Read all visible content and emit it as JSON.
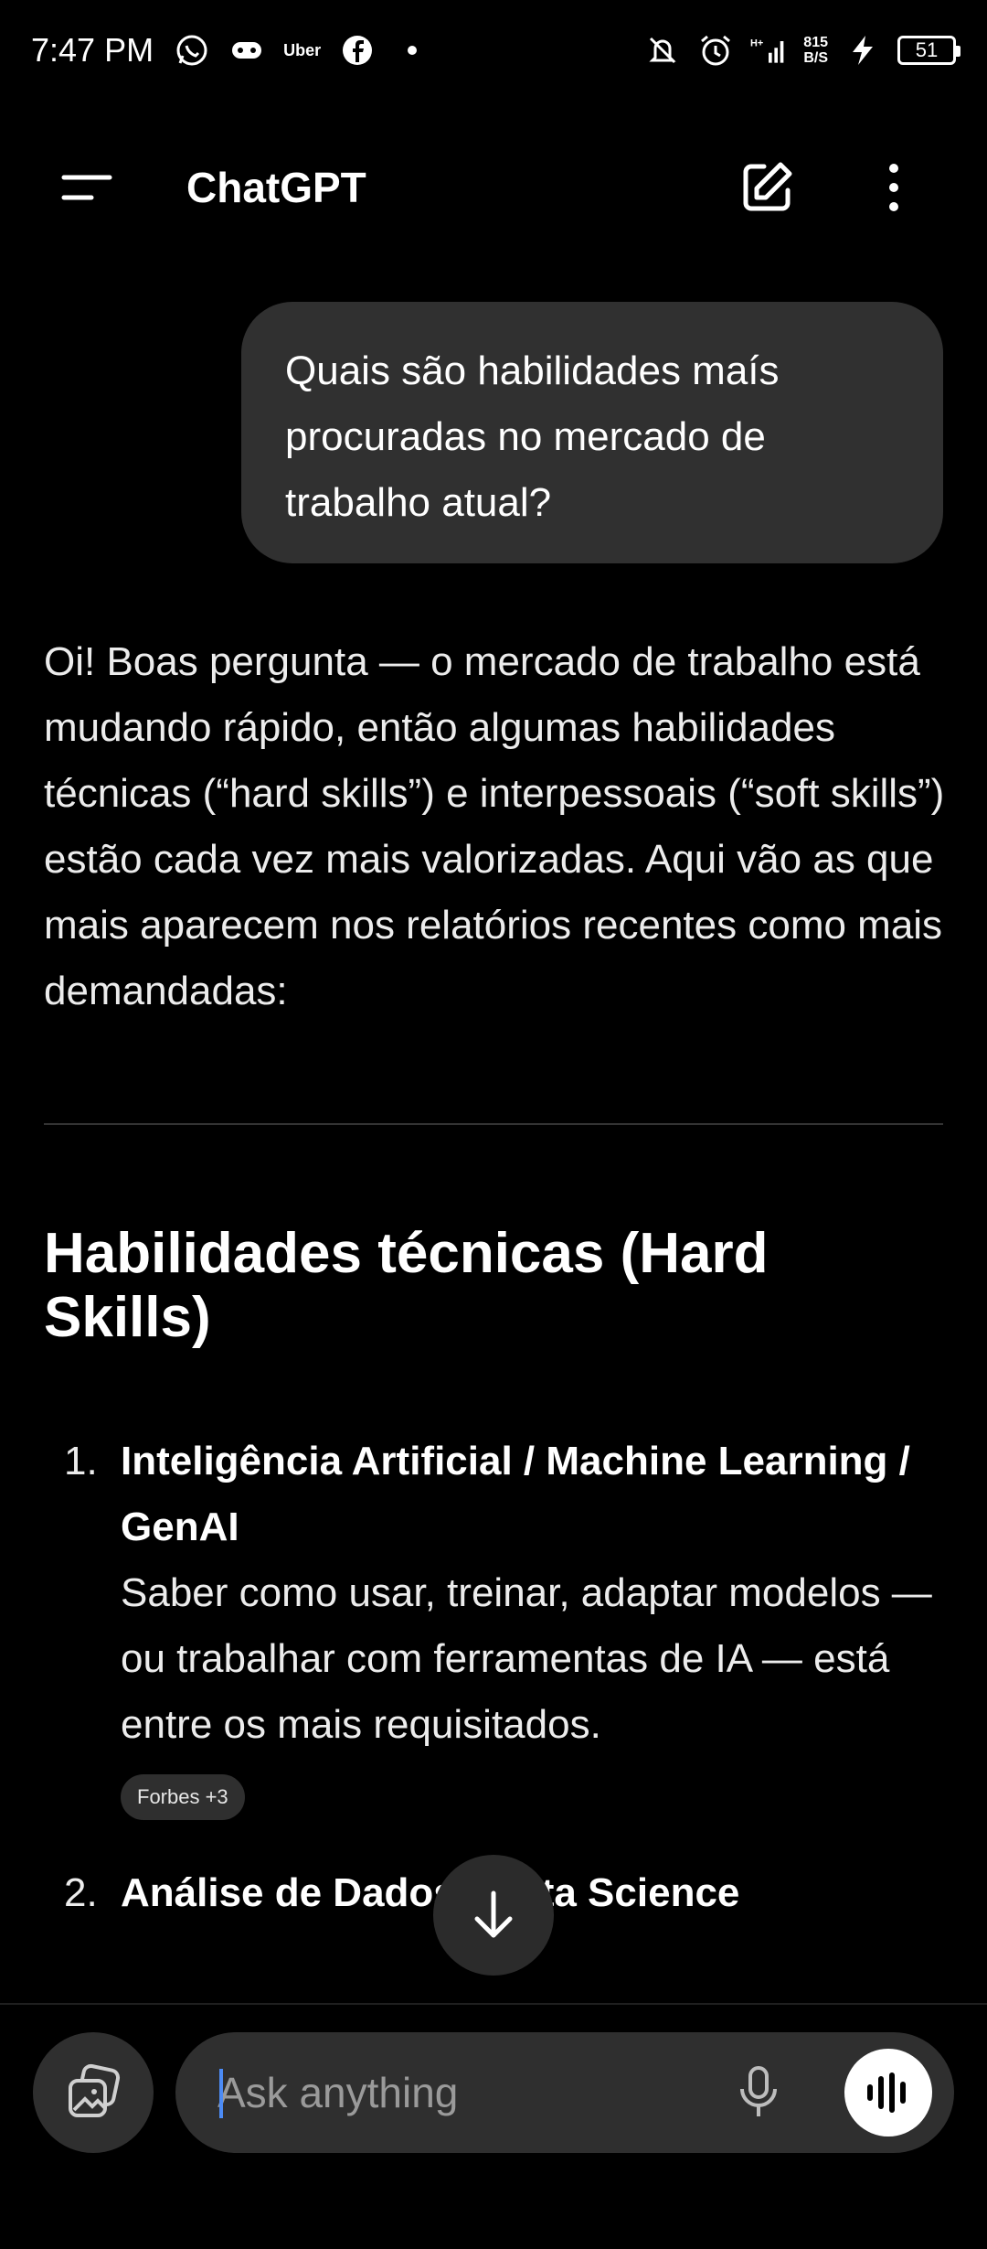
{
  "status_bar": {
    "time": "7:47 PM",
    "uber_label": "Uber",
    "net_speed_value": "815",
    "net_speed_unit": "B/S",
    "battery_level": "51",
    "icons": [
      "whatsapp-icon",
      "game-icon",
      "uber-icon",
      "facebook-icon",
      "dot-icon",
      "bell-muted-icon",
      "alarm-icon",
      "signal-icon",
      "charging-icon",
      "battery-icon"
    ]
  },
  "header": {
    "title": "ChatGPT"
  },
  "conversation": {
    "user_message": "Quais são habilidades maís procuradas no mercado de trabalho atual?",
    "assistant_intro": "Oi! Boas pergunta — o mercado de trabalho está mudando rápido, então algumas habilidades técnicas (“hard skills”) e interpessoais (“soft skills”) estão cada vez mais valorizadas. Aqui vão as que mais aparecem nos relatórios recentes como mais demandadas:",
    "section_heading": "Habilidades técnicas (Hard Skills)",
    "items": [
      {
        "number": "1.",
        "title": "Inteligência Artificial / Machine Learning / GenAI",
        "description": "Saber como usar, treinar, adaptar modelos — ou trabalhar com ferramentas de IA — está entre os mais requisitados.",
        "source": "Forbes +3"
      },
      {
        "number": "2.",
        "title": "Análise de Dados / Data Science",
        "description": "",
        "source": ""
      }
    ]
  },
  "composer": {
    "placeholder": "Ask anything"
  },
  "colors": {
    "background": "#000000",
    "bubble": "#303030",
    "composer_field": "#2f2f2f",
    "caret": "#4c8bf5"
  }
}
